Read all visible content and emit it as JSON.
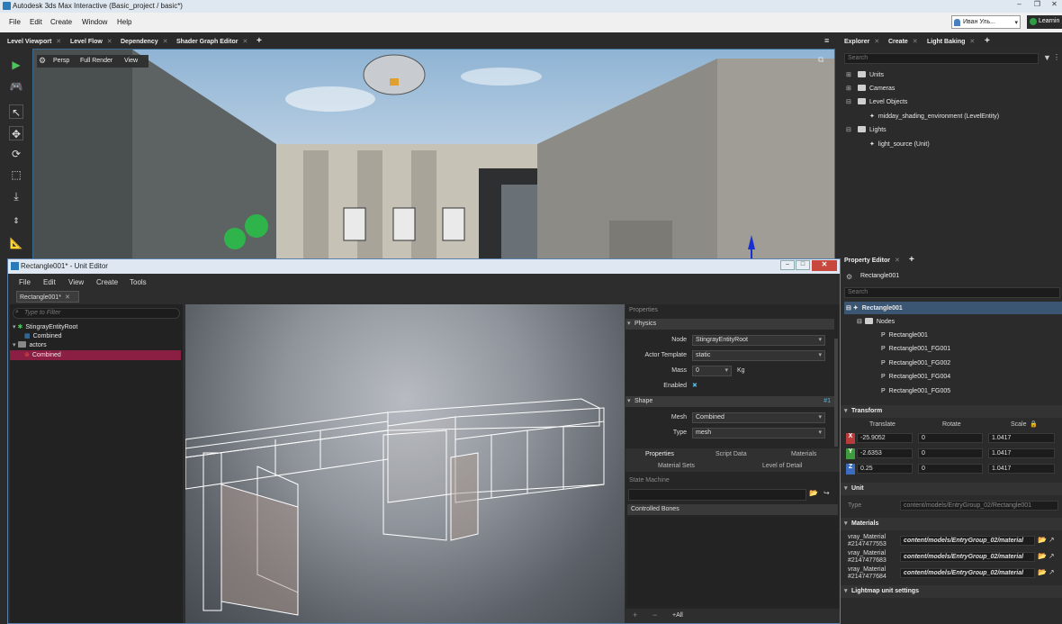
{
  "app": {
    "title": "Autodesk 3ds Max Interactive (Basic_project / basic*)"
  },
  "menu": [
    "File",
    "Edit",
    "Create",
    "Window",
    "Help"
  ],
  "user": {
    "name": "Иван Уль...",
    "learn": "Learnin"
  },
  "doc_tabs": [
    "Level Viewport",
    "Level Flow",
    "Dependency",
    "Shader Graph Editor"
  ],
  "viewport": {
    "buttons": [
      "Persp",
      "Full Render",
      "View"
    ]
  },
  "explorer": {
    "tabs": [
      "Explorer",
      "Create",
      "Light Baking"
    ],
    "search_placeholder": "Search",
    "tree": [
      {
        "label": "Units",
        "level": 0
      },
      {
        "label": "Cameras",
        "level": 0
      },
      {
        "label": "Level Objects",
        "level": 0
      },
      {
        "label": "midday_shading_environment (LevelEntity)",
        "level": 1
      },
      {
        "label": "Lights",
        "level": 0
      },
      {
        "label": "light_source (Unit)",
        "level": 1
      }
    ]
  },
  "property_editor": {
    "tab": "Property Editor",
    "object": "Rectangle001",
    "search_placeholder": "Search",
    "tree": [
      "Rectangle001",
      "Nodes",
      "Rectangle001",
      "Rectangle001_FG001",
      "Rectangle001_FG002",
      "Rectangle001_FG004",
      "Rectangle001_FG005"
    ],
    "transform": {
      "title": "Transform",
      "headers": [
        "Translate",
        "Rotate",
        "Scale"
      ],
      "rows": [
        {
          "axis": "X",
          "translate": "-25.9052",
          "rotate": "0",
          "scale": "1.0417"
        },
        {
          "axis": "Y",
          "translate": "-2.6353",
          "rotate": "0",
          "scale": "1.0417"
        },
        {
          "axis": "Z",
          "translate": "0.25",
          "rotate": "0",
          "scale": "1.0417"
        }
      ]
    },
    "unit": {
      "title": "Unit",
      "type_label": "Type",
      "type_value": "content/models/EntryGroup_02/Rectangle001"
    },
    "materials": {
      "title": "Materials",
      "items": [
        {
          "name1": "vray_Material",
          "name2": "#2147477553",
          "path": "content/models/EntryGroup_02/material"
        },
        {
          "name1": "vray_Material",
          "name2": "#2147477683",
          "path": "content/models/EntryGroup_02/material"
        },
        {
          "name1": "vray_Material",
          "name2": "#2147477684",
          "path": "content/models/EntryGroup_02/material"
        }
      ]
    },
    "lightmap": "Lightmap unit settings"
  },
  "unit_editor": {
    "title": "Rectangle001* - Unit Editor",
    "menu": [
      "File",
      "Edit",
      "View",
      "Create",
      "Tools"
    ],
    "tab": "Rectangle001*",
    "filter_placeholder": "Type to Filter",
    "outliner": [
      {
        "label": "StingrayEntityRoot",
        "level": 0
      },
      {
        "label": "Combined",
        "level": 1
      },
      {
        "label": "actors",
        "level": 0
      },
      {
        "label": "Combined",
        "level": 1,
        "selected": true
      }
    ],
    "props": {
      "title": "Properties",
      "physics": "Physics",
      "node_label": "Node",
      "node_value": "StingrayEntityRoot",
      "actor_label": "Actor Template",
      "actor_value": "static",
      "mass_label": "Mass",
      "mass_value": "0",
      "mass_unit": "Kg",
      "enabled_label": "Enabled",
      "shape": "Shape",
      "shape_index": "#1",
      "mesh_label": "Mesh",
      "mesh_value": "Combined",
      "type_label": "Type",
      "type_value": "mesh",
      "tabs_row1": [
        "Properties",
        "Script Data",
        "Materials"
      ],
      "tabs_row2": [
        "Material Sets",
        "Level of Detail"
      ],
      "state_machine": "State Machine",
      "controlled_bones": "Controlled Bones",
      "add_all": "+All"
    }
  }
}
